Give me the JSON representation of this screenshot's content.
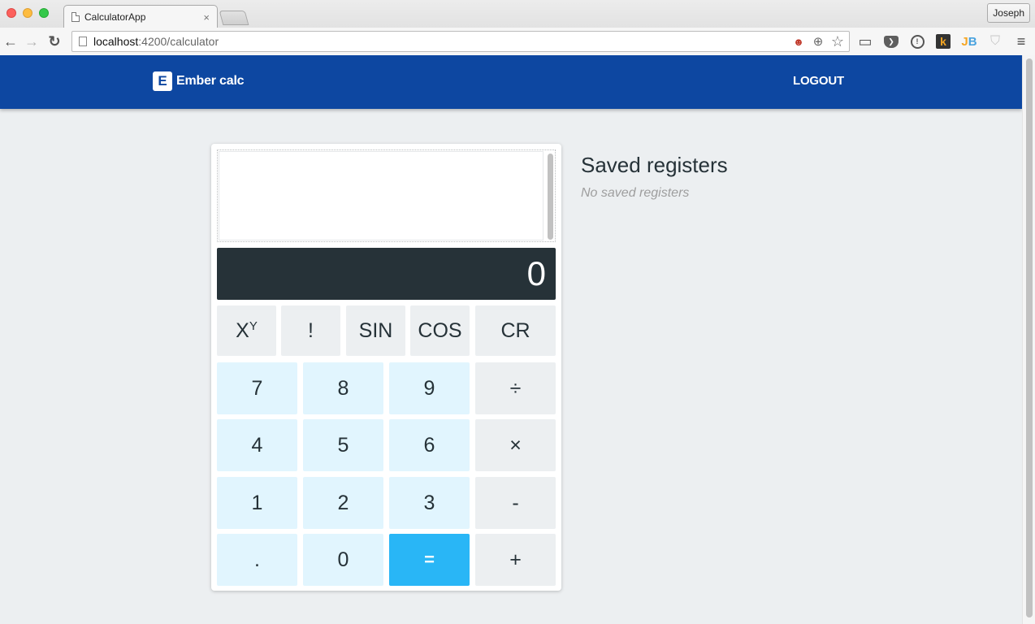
{
  "browser": {
    "tab": {
      "title": "CalculatorApp",
      "close_glyph": "×"
    },
    "profile_label": "Joseph",
    "url": {
      "host": "localhost",
      "rest": ":4200/calculator"
    },
    "icons": {
      "back": "←",
      "forward": "→",
      "reload": "↻",
      "zoom": "⊕",
      "star": "☆",
      "cast": "▭",
      "pocket": "❯",
      "onepassword": "!",
      "k": "k",
      "jb_j": "J",
      "jb_b": "B",
      "shield": "⛉",
      "menu": "≡"
    }
  },
  "app": {
    "brand": {
      "logo_letter": "E",
      "name": "Ember calc"
    },
    "nav": {
      "logout_label": "LOGOUT"
    },
    "colors": {
      "primary": "#0d47a1",
      "display_bg": "#263238",
      "equals": "#29b6f6",
      "number_key": "#e1f5fe",
      "function_key": "#eceff1"
    }
  },
  "calculator": {
    "history": "",
    "display_value": "0",
    "function_keys": [
      {
        "label": "X",
        "sup": "Y",
        "name": "power"
      },
      {
        "label": "!",
        "name": "factorial"
      },
      {
        "label": "SIN",
        "name": "sin"
      },
      {
        "label": "COS",
        "name": "cos"
      },
      {
        "label": "CR",
        "name": "clear"
      }
    ],
    "keypad": [
      [
        {
          "label": "7",
          "type": "num"
        },
        {
          "label": "8",
          "type": "num"
        },
        {
          "label": "9",
          "type": "num"
        },
        {
          "label": "÷",
          "type": "op",
          "name": "divide"
        }
      ],
      [
        {
          "label": "4",
          "type": "num"
        },
        {
          "label": "5",
          "type": "num"
        },
        {
          "label": "6",
          "type": "num"
        },
        {
          "label": "×",
          "type": "op",
          "name": "multiply"
        }
      ],
      [
        {
          "label": "1",
          "type": "num"
        },
        {
          "label": "2",
          "type": "num"
        },
        {
          "label": "3",
          "type": "num"
        },
        {
          "label": "-",
          "type": "op",
          "name": "subtract"
        }
      ],
      [
        {
          "label": ".",
          "type": "num",
          "name": "decimal"
        },
        {
          "label": "0",
          "type": "num"
        },
        {
          "label": "=",
          "type": "eq",
          "name": "equals"
        },
        {
          "label": "+",
          "type": "op",
          "name": "add"
        }
      ]
    ]
  },
  "registers": {
    "title": "Saved registers",
    "empty_message": "No saved registers"
  }
}
